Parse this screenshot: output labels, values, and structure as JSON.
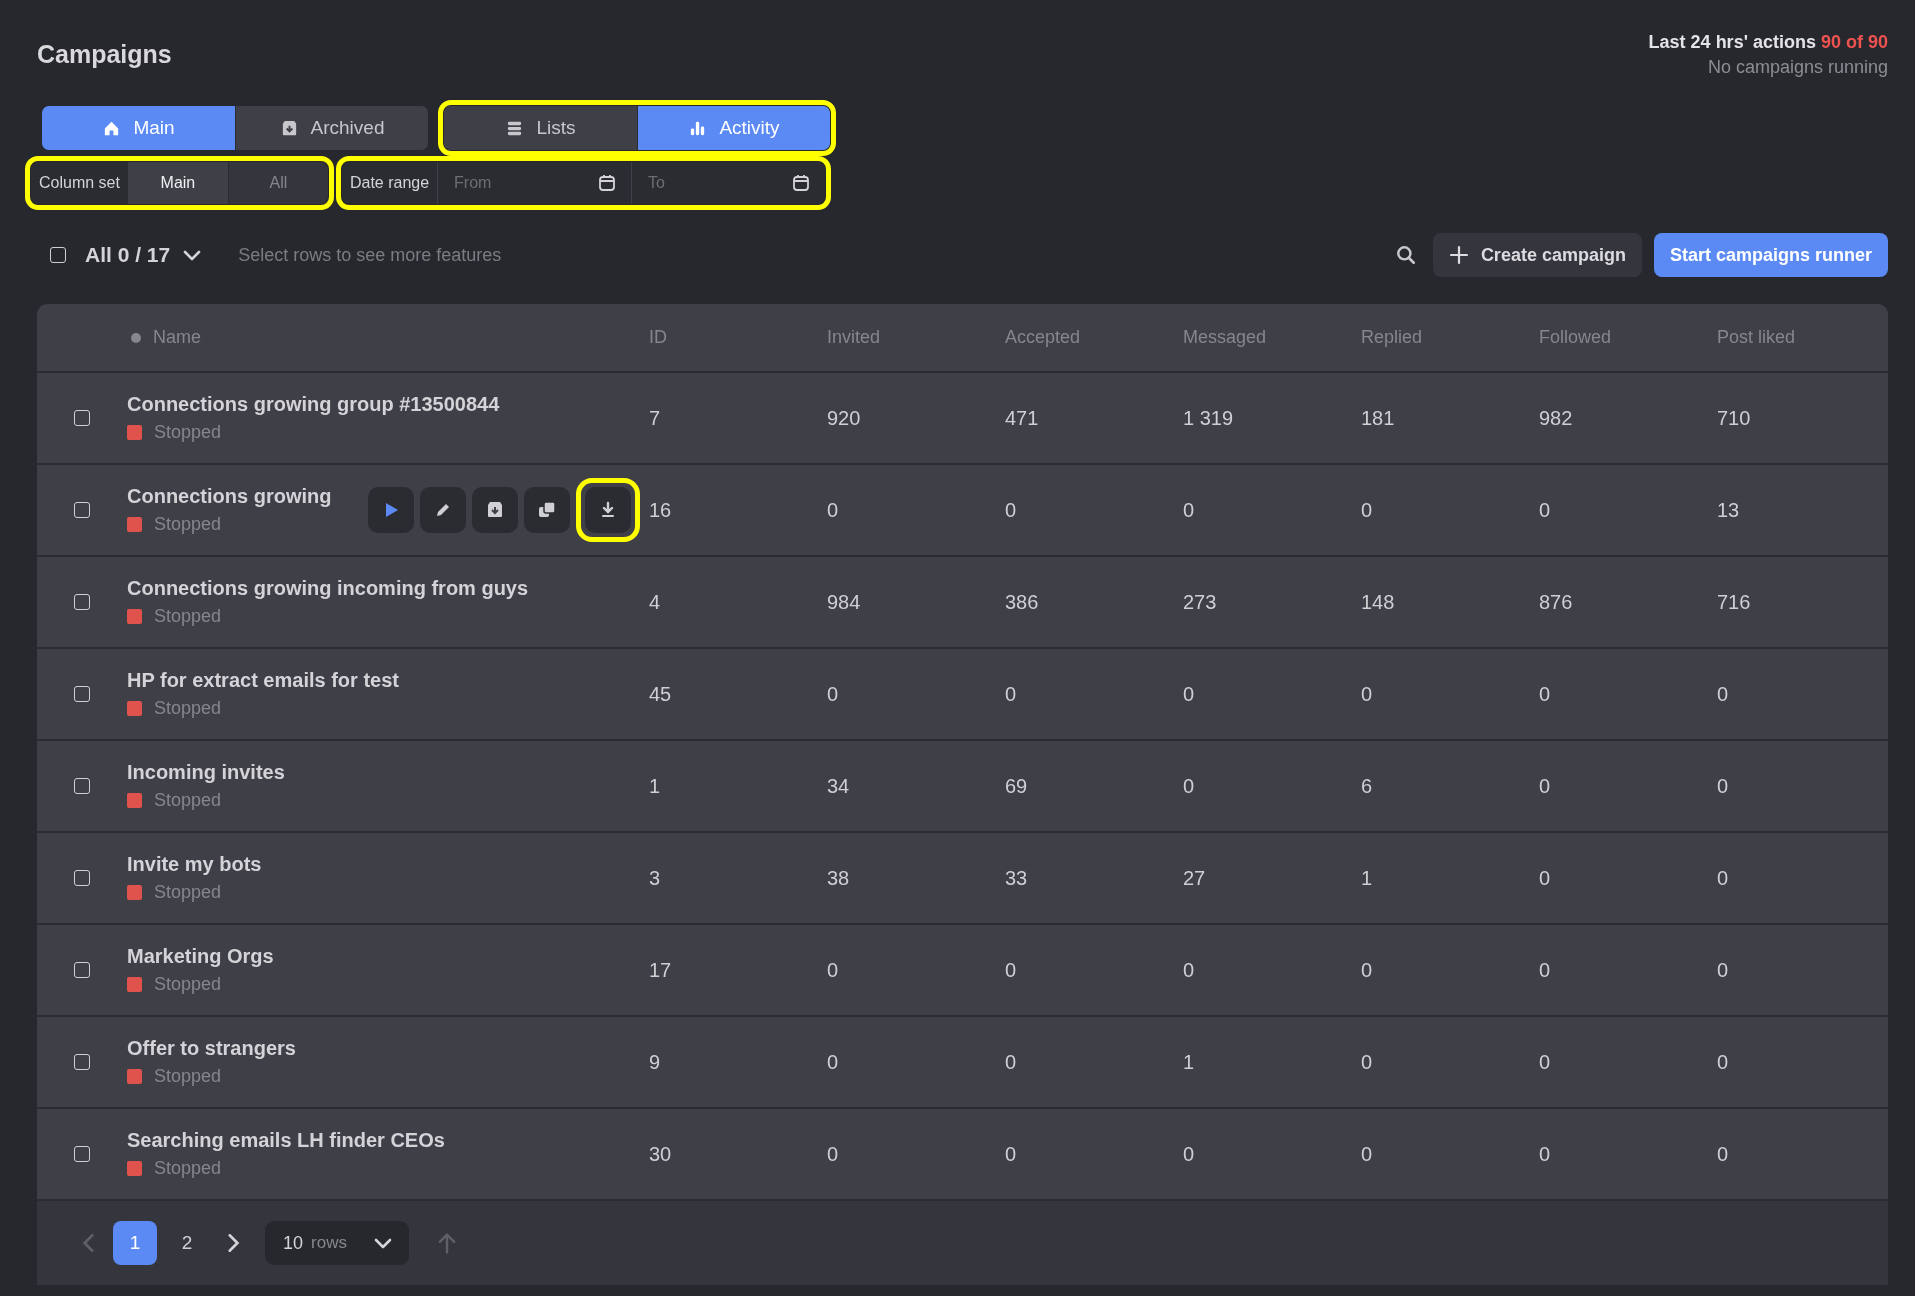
{
  "page": {
    "title": "Campaigns"
  },
  "usage": {
    "label": "Last 24 hrs' actions",
    "count": "90 of 90",
    "status": "No campaigns running"
  },
  "view_tabs": [
    {
      "label": "Main",
      "kind": "home",
      "selected": true
    },
    {
      "label": "Archived",
      "kind": "archive",
      "selected": false
    }
  ],
  "mode_tabs": {
    "highlighted": true,
    "items": [
      {
        "label": "Lists",
        "kind": "list",
        "selected": false
      },
      {
        "label": "Activity",
        "kind": "chart",
        "selected": true
      }
    ]
  },
  "column_set": {
    "highlighted": true,
    "label": "Column set",
    "options": [
      {
        "label": "Main",
        "selected": true
      },
      {
        "label": "All",
        "selected": false
      }
    ]
  },
  "date_range": {
    "highlighted": true,
    "label": "Date range",
    "from": {
      "placeholder": "From"
    },
    "to": {
      "placeholder": "To"
    }
  },
  "selection": {
    "checked": false,
    "label": "All 0 / 17",
    "hint": "Select rows to see more features"
  },
  "actions": [
    {
      "label": "Create campaign",
      "kind": "secondary"
    },
    {
      "label": "Start campaigns runner",
      "kind": "primary"
    }
  ],
  "table": {
    "name_column": "Name",
    "columns": [
      "ID",
      "Invited",
      "Accepted",
      "Messaged",
      "Replied",
      "Followed",
      "Post liked"
    ],
    "rows": [
      {
        "checked": false,
        "name": "Connections growing group #13500844",
        "status": "Stopped",
        "cells": [
          "7",
          "920",
          "471",
          "1 319",
          "181",
          "982",
          "710"
        ]
      },
      {
        "checked": false,
        "name": "Connections growing",
        "status": "Stopped",
        "cells": [
          "16",
          "0",
          "0",
          "0",
          "0",
          "0",
          "13"
        ],
        "hover_actions": [
          {
            "kind": "play",
            "highlighted": false
          },
          {
            "kind": "edit",
            "highlighted": false
          },
          {
            "kind": "archive",
            "highlighted": false
          },
          {
            "kind": "copy",
            "highlighted": false
          },
          {
            "kind": "download",
            "highlighted": true
          }
        ]
      },
      {
        "checked": false,
        "name": "Connections growing incoming from guys",
        "status": "Stopped",
        "cells": [
          "4",
          "984",
          "386",
          "273",
          "148",
          "876",
          "716"
        ]
      },
      {
        "checked": false,
        "name": "HP for extract emails for test",
        "status": "Stopped",
        "cells": [
          "45",
          "0",
          "0",
          "0",
          "0",
          "0",
          "0"
        ]
      },
      {
        "checked": false,
        "name": "Incoming invites",
        "status": "Stopped",
        "cells": [
          "1",
          "34",
          "69",
          "0",
          "6",
          "0",
          "0"
        ]
      },
      {
        "checked": false,
        "name": "Invite my bots",
        "status": "Stopped",
        "cells": [
          "3",
          "38",
          "33",
          "27",
          "1",
          "0",
          "0"
        ]
      },
      {
        "checked": false,
        "name": "Marketing Orgs",
        "status": "Stopped",
        "cells": [
          "17",
          "0",
          "0",
          "0",
          "0",
          "0",
          "0"
        ]
      },
      {
        "checked": false,
        "name": "Offer to strangers",
        "status": "Stopped",
        "cells": [
          "9",
          "0",
          "0",
          "1",
          "0",
          "0",
          "0"
        ]
      },
      {
        "checked": false,
        "name": "Searching emails LH finder CEOs",
        "status": "Stopped",
        "cells": [
          "30",
          "0",
          "0",
          "0",
          "0",
          "0",
          "0"
        ]
      }
    ]
  },
  "pagination": {
    "pages": [
      {
        "label": "1",
        "selected": true
      },
      {
        "label": "2",
        "selected": false
      }
    ],
    "rows_per_page": {
      "value": "10",
      "unit": "rows"
    }
  }
}
